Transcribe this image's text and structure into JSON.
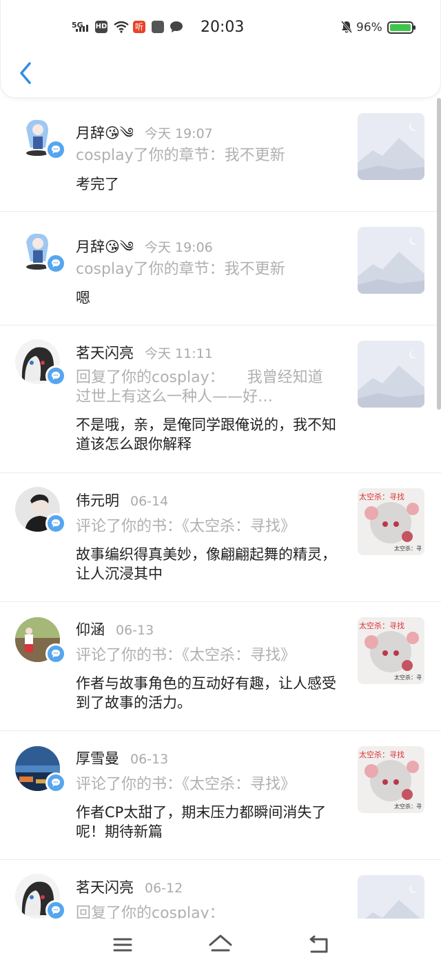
{
  "status_bar": {
    "network": "5G",
    "hd": "HD",
    "listen_badge": "听",
    "time": "20:03",
    "battery_percent": "96%"
  },
  "header": {
    "back_icon": "chevron-left-icon",
    "accent_color": "#2f8de4"
  },
  "notifications": [
    {
      "name": "月辞😘༄",
      "time": "今天 19:07",
      "action": "cosplay了你的章节：我不更新",
      "content": "考完了",
      "thumb": "placeholder"
    },
    {
      "name": "月辞😘༄",
      "time": "今天 19:06",
      "action": "cosplay了你的章节：我不更新",
      "content": "嗯",
      "thumb": "placeholder"
    },
    {
      "name": "茗天闪亮",
      "time": "今天 11:11",
      "action": "回复了你的cosplay：　　我曾经知道过世上有这么一种人——好…",
      "content": "不是哦，亲，是俺同学跟俺说的，我不知道该怎么跟你解释",
      "thumb": "placeholder"
    },
    {
      "name": "伟元明",
      "time": "06-14",
      "action": "评论了你的书：《太空杀：寻找》",
      "content": "故事编织得真美妙，像翩翩起舞的精灵，让人沉浸其中",
      "thumb": "book",
      "thumb_title": "太空杀：寻找",
      "thumb_caption": "太空杀：寻"
    },
    {
      "name": "仰涵",
      "time": "06-13",
      "action": "评论了你的书：《太空杀：寻找》",
      "content": "作者与故事角色的互动好有趣，让人感受到了故事的活力。",
      "thumb": "book",
      "thumb_title": "太空杀：寻找",
      "thumb_caption": "太空杀：寻"
    },
    {
      "name": "厚雪曼",
      "time": "06-13",
      "action": "评论了你的书：《太空杀：寻找》",
      "content": "作者CP太甜了，期末压力都瞬间消失了呢！期待新篇",
      "thumb": "book",
      "thumb_title": "太空杀：寻找",
      "thumb_caption": "太空杀：寻"
    },
    {
      "name": "茗天闪亮",
      "time": "06-12",
      "action": "回复了你的cosplay：",
      "content": "",
      "thumb": "placeholder"
    }
  ],
  "nav": {
    "menu_icon": "menu-icon",
    "home_icon": "home-icon",
    "back_icon": "back-icon"
  }
}
